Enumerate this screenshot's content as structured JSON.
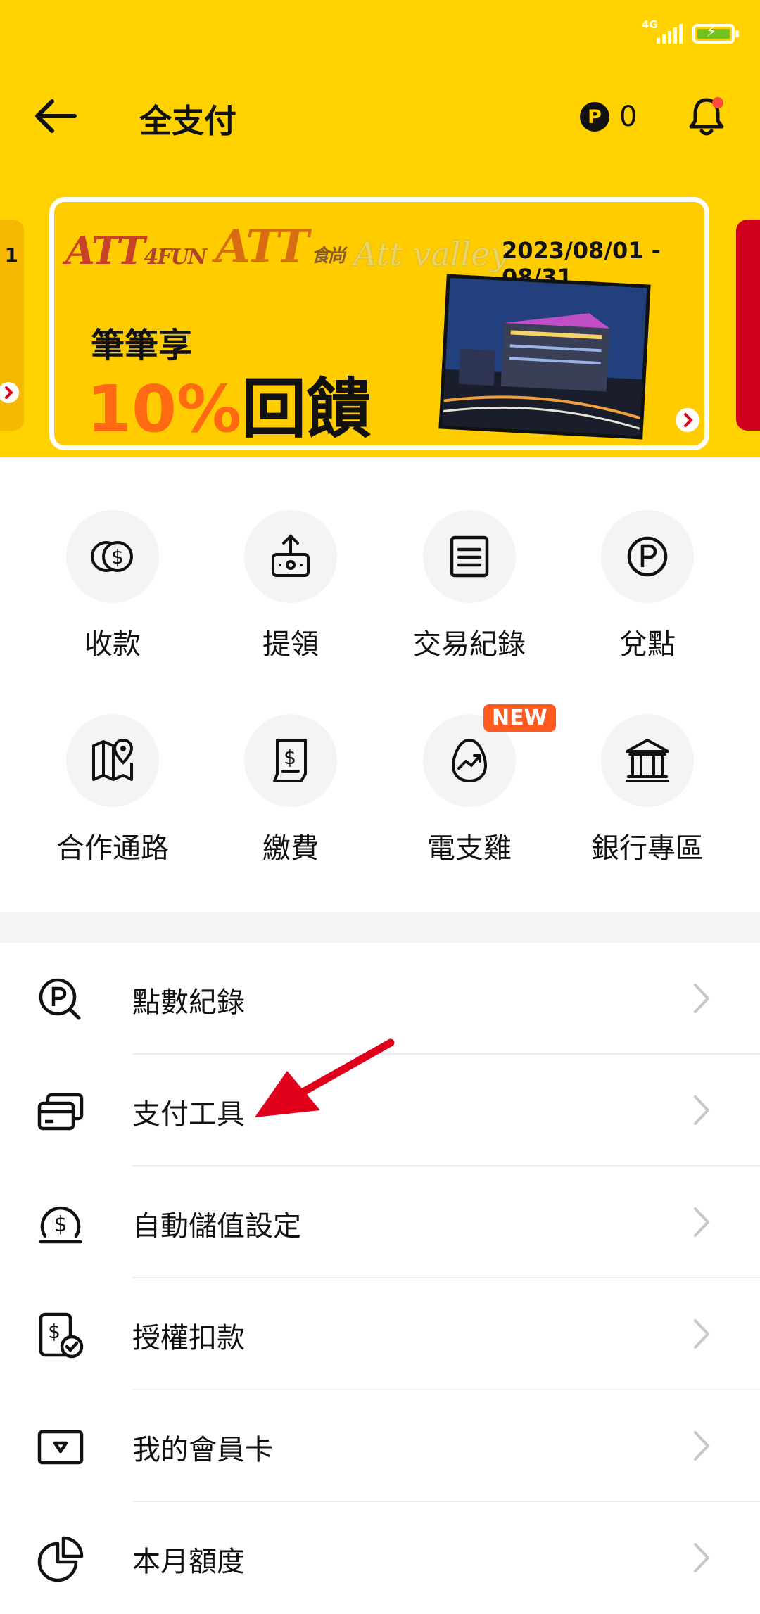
{
  "status_bar": {
    "network": "4G"
  },
  "header": {
    "title": "全支付",
    "points_value": "0",
    "points_symbol": "P"
  },
  "banner": {
    "left_peek_text": "1",
    "logos": [
      "ATT4FUN",
      "ATT 食尚",
      "Att valley"
    ],
    "date_range": "2023/08/01 - 08/31",
    "subtitle": "筆筆享",
    "headline_percent": "10%",
    "headline_text": "回饋"
  },
  "quick_actions": [
    {
      "label": "收款",
      "icon": "coins-dollar-icon"
    },
    {
      "label": "提領",
      "icon": "withdraw-icon"
    },
    {
      "label": "交易紀錄",
      "icon": "document-list-icon"
    },
    {
      "label": "兌點",
      "icon": "points-p-icon"
    },
    {
      "label": "合作通路",
      "icon": "map-pin-icon"
    },
    {
      "label": "繳費",
      "icon": "bill-receipt-icon"
    },
    {
      "label": "電支雞",
      "icon": "egg-growth-icon",
      "badge": "NEW"
    },
    {
      "label": "銀行專區",
      "icon": "bank-icon"
    }
  ],
  "menu": [
    {
      "label": "點數紀錄",
      "icon": "points-search-icon"
    },
    {
      "label": "支付工具",
      "icon": "cards-icon"
    },
    {
      "label": "自動儲值設定",
      "icon": "auto-topup-dollar-icon"
    },
    {
      "label": "授權扣款",
      "icon": "authorized-debit-icon"
    },
    {
      "label": "我的會員卡",
      "icon": "member-card-icon"
    },
    {
      "label": "本月額度",
      "icon": "pie-chart-icon"
    }
  ],
  "colors": {
    "brand_yellow": "#FFD200",
    "accent_orange": "#FF5A1F",
    "annotation_red": "#E0001B"
  }
}
